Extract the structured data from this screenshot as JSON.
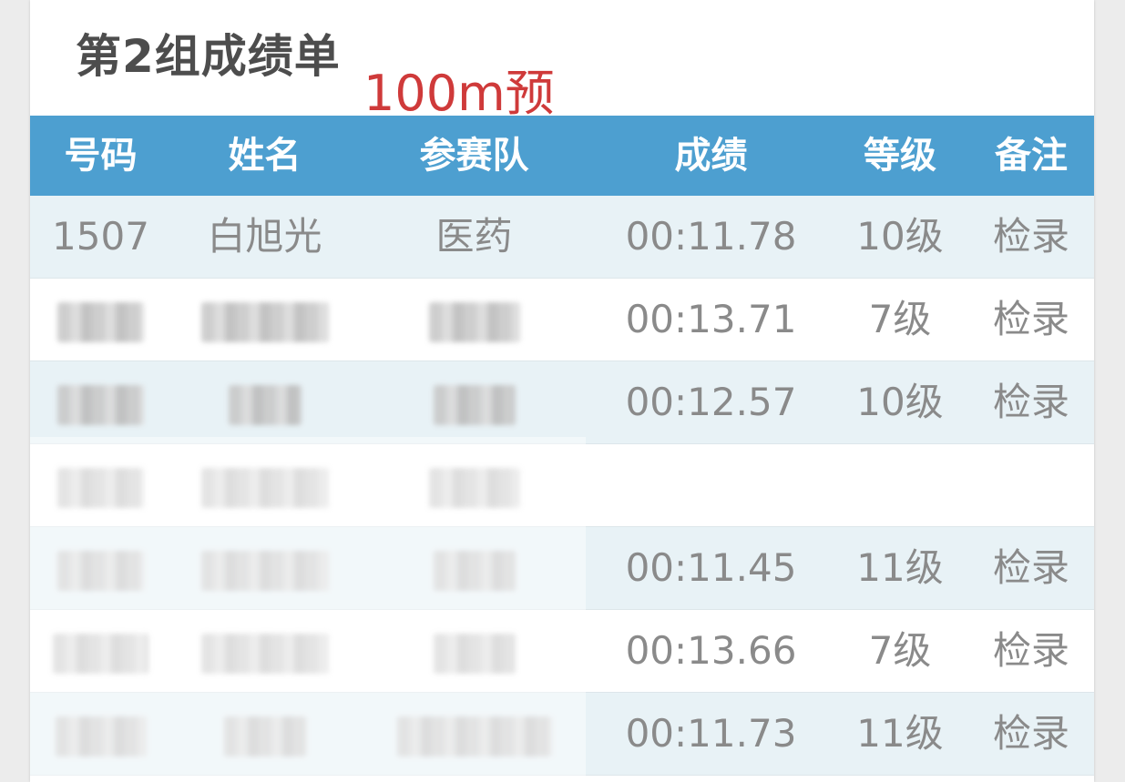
{
  "header": {
    "title": "第2组成绩单",
    "annotation": "100m预"
  },
  "table": {
    "columns": [
      "号码",
      "姓名",
      "参赛队",
      "成绩",
      "等级",
      "备注"
    ],
    "rows": [
      {
        "number": "1507",
        "name": "白旭光",
        "team": "医药",
        "score": "00:11.78",
        "grade": "10级",
        "note": "检录",
        "redacted": false
      },
      {
        "number": "",
        "name": "",
        "team": "",
        "score": "00:13.71",
        "grade": "7级",
        "note": "检录",
        "redacted": true
      },
      {
        "number": "",
        "name": "",
        "team": "",
        "score": "00:12.57",
        "grade": "10级",
        "note": "检录",
        "redacted": true
      },
      {
        "number": "",
        "name": "",
        "team": "",
        "score": "",
        "grade": "",
        "note": "",
        "redacted": true
      },
      {
        "number": "",
        "name": "",
        "team": "",
        "score": "00:11.45",
        "grade": "11级",
        "note": "检录",
        "redacted": true
      },
      {
        "number": "",
        "name": "",
        "team": "",
        "score": "00:13.66",
        "grade": "7级",
        "note": "检录",
        "redacted": true
      },
      {
        "number": "",
        "name": "",
        "team": "",
        "score": "00:11.73",
        "grade": "11级",
        "note": "检录",
        "redacted": true
      }
    ]
  },
  "colors": {
    "header_bg": "#4d9fd0",
    "row_alt_bg": "#e8f2f6",
    "annotation": "#cf3a3a",
    "cell_text": "#8a8a8a"
  }
}
